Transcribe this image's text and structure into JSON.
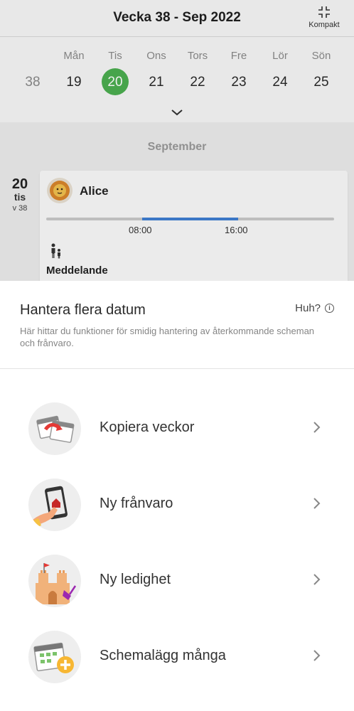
{
  "header": {
    "title": "Vecka 38 - Sep 2022",
    "compact_label": "Kompakt"
  },
  "week": {
    "days": [
      {
        "name": "",
        "date": "38"
      },
      {
        "name": "Mån",
        "date": "19"
      },
      {
        "name": "Tis",
        "date": "20"
      },
      {
        "name": "Ons",
        "date": "21"
      },
      {
        "name": "Tors",
        "date": "22"
      },
      {
        "name": "Fre",
        "date": "23"
      },
      {
        "name": "Lör",
        "date": "24"
      },
      {
        "name": "Sön",
        "date": "25"
      }
    ],
    "selected_color": "#4caf50"
  },
  "schedule": {
    "month_label": "September",
    "day_number": "20",
    "day_name": "tis",
    "week_label": "v 38",
    "child_name": "Alice",
    "start_time": "08:00",
    "end_time": "16:00",
    "message_label": "Meddelande",
    "bar_color": "#3f7fd3"
  },
  "sheet": {
    "title": "Hantera flera datum",
    "help_label": "Huh?",
    "description": "Här hittar du funktioner för smidig hantering av återkommande scheman och frånvaro.",
    "items": [
      {
        "label": "Kopiera veckor",
        "icon": "copy-weeks-icon"
      },
      {
        "label": "Ny frånvaro",
        "icon": "absence-phone-icon"
      },
      {
        "label": "Ny ledighet",
        "icon": "sandcastle-icon"
      },
      {
        "label": "Schemalägg många",
        "icon": "schedule-many-icon"
      }
    ]
  }
}
